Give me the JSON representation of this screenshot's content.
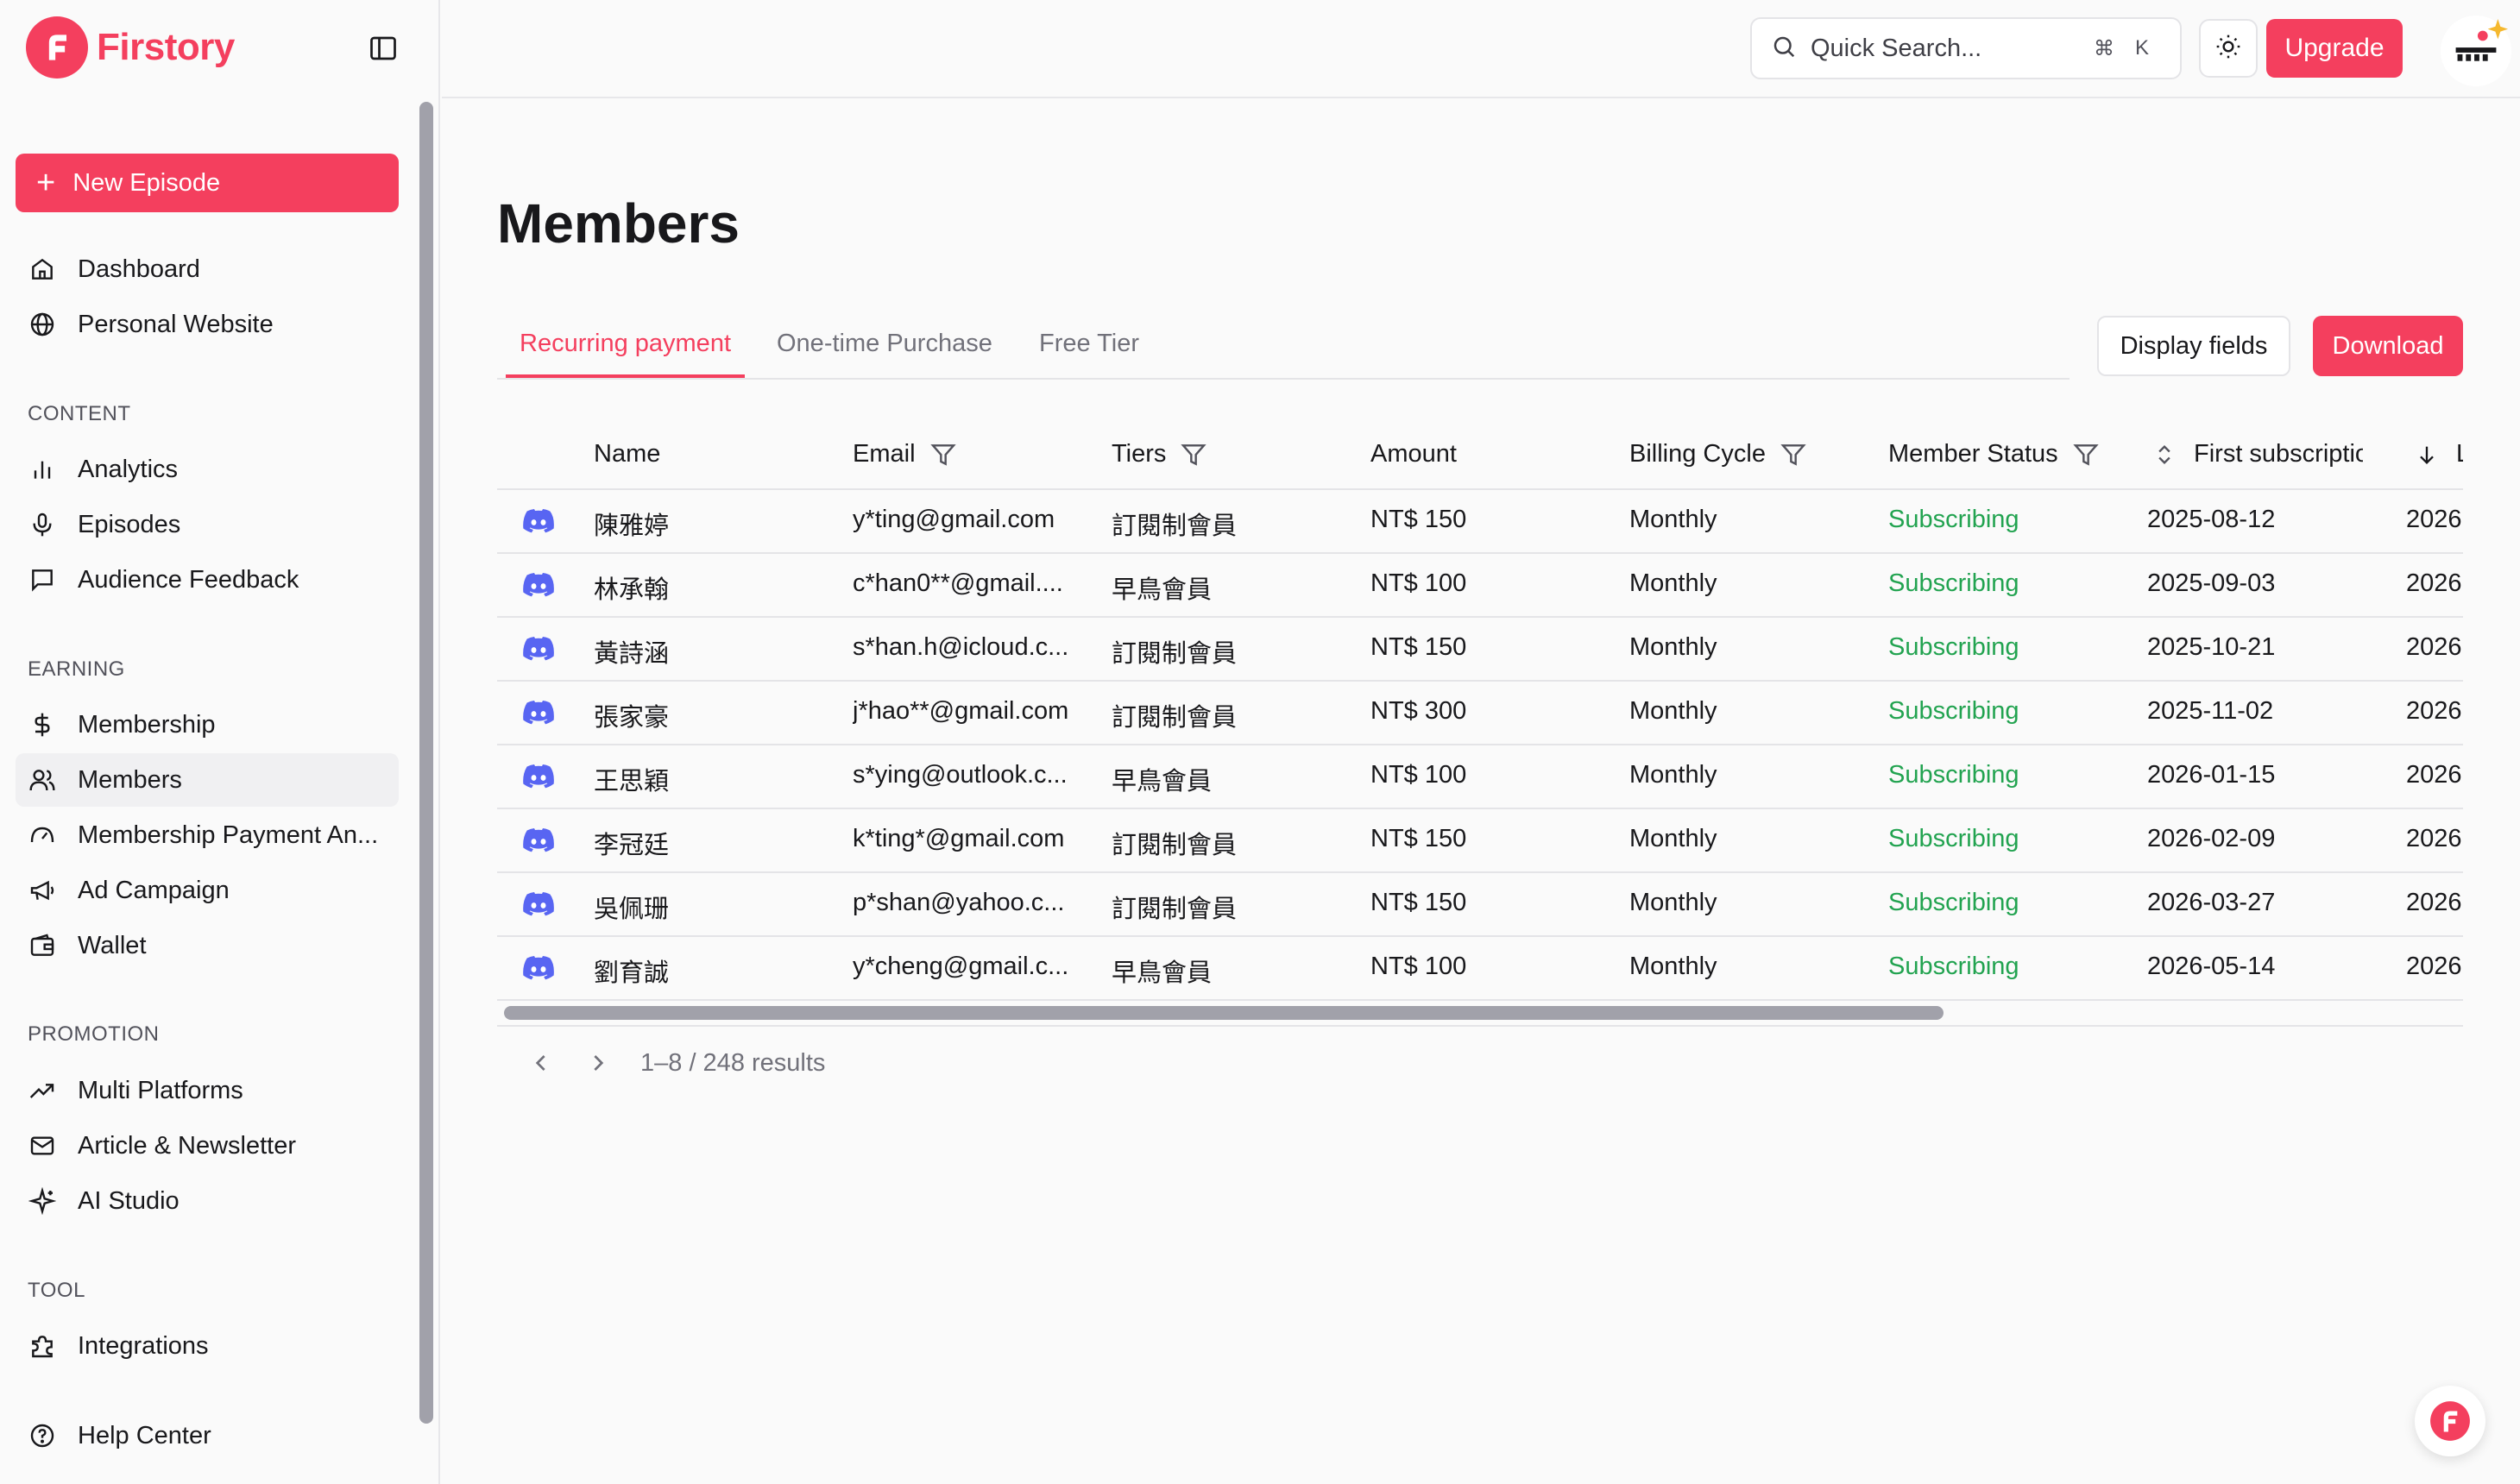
{
  "brand": {
    "name": "Firstory"
  },
  "sidebar": {
    "new_episode_label": "New Episode",
    "top_items": [
      {
        "label": "Dashboard",
        "icon": "home-icon"
      },
      {
        "label": "Personal Website",
        "icon": "globe-icon"
      }
    ],
    "sections": [
      {
        "title": "CONTENT",
        "items": [
          {
            "label": "Analytics",
            "icon": "bar-chart-icon"
          },
          {
            "label": "Episodes",
            "icon": "microphone-icon"
          },
          {
            "label": "Audience Feedback",
            "icon": "message-square-icon"
          }
        ]
      },
      {
        "title": "EARNING",
        "items": [
          {
            "label": "Membership",
            "icon": "dollar-icon"
          },
          {
            "label": "Members",
            "icon": "users-icon",
            "active": true
          },
          {
            "label": "Membership Payment An...",
            "icon": "gauge-icon"
          },
          {
            "label": "Ad Campaign",
            "icon": "megaphone-icon"
          },
          {
            "label": "Wallet",
            "icon": "wallet-icon"
          }
        ]
      },
      {
        "title": "PROMOTION",
        "items": [
          {
            "label": "Multi Platforms",
            "icon": "trending-up-icon"
          },
          {
            "label": "Article & Newsletter",
            "icon": "mail-icon"
          },
          {
            "label": "AI Studio",
            "icon": "sparkles-icon"
          }
        ]
      },
      {
        "title": "TOOL",
        "items": [
          {
            "label": "Integrations",
            "icon": "puzzle-icon"
          }
        ]
      }
    ],
    "help_label": "Help Center"
  },
  "topbar": {
    "search_placeholder": "Quick Search...",
    "shortcut_cmd": "⌘",
    "shortcut_key": "K",
    "upgrade_label": "Upgrade"
  },
  "main": {
    "title": "Members",
    "tabs": [
      "Recurring payment",
      "One-time Purchase",
      "Free Tier"
    ],
    "active_tab": 0,
    "display_fields_label": "Display fields",
    "download_label": "Download",
    "accent": "#f43f5e",
    "status_color": "#22a350"
  },
  "table": {
    "columns": [
      "Name",
      "Email",
      "Tiers",
      "Amount",
      "Billing Cycle",
      "Member Status",
      "First subscriptio",
      "L"
    ],
    "rows": [
      {
        "platform": "discord-icon",
        "name": "陳雅婷",
        "email": "y*ting@gmail.com",
        "tier": "訂閱制會員",
        "amount": "NT$ 150",
        "cycle": "Monthly",
        "status": "Subscribing",
        "first": "2025-08-12",
        "last": "2026"
      },
      {
        "platform": "discord-icon",
        "name": "林承翰",
        "email": "c*han0**@gmail....",
        "tier": "早鳥會員",
        "amount": "NT$ 100",
        "cycle": "Monthly",
        "status": "Subscribing",
        "first": "2025-09-03",
        "last": "2026"
      },
      {
        "platform": "discord-icon",
        "name": "黃詩涵",
        "email": "s*han.h@icloud.c...",
        "tier": "訂閱制會員",
        "amount": "NT$ 150",
        "cycle": "Monthly",
        "status": "Subscribing",
        "first": "2025-10-21",
        "last": "2026"
      },
      {
        "platform": "discord-icon",
        "name": "張家豪",
        "email": "j*hao**@gmail.com",
        "tier": "訂閱制會員",
        "amount": "NT$ 300",
        "cycle": "Monthly",
        "status": "Subscribing",
        "first": "2025-11-02",
        "last": "2026"
      },
      {
        "platform": "discord-icon",
        "name": "王思穎",
        "email": "s*ying@outlook.c...",
        "tier": "早鳥會員",
        "amount": "NT$ 100",
        "cycle": "Monthly",
        "status": "Subscribing",
        "first": "2026-01-15",
        "last": "2026"
      },
      {
        "platform": "discord-icon",
        "name": "李冠廷",
        "email": "k*ting*@gmail.com",
        "tier": "訂閱制會員",
        "amount": "NT$ 150",
        "cycle": "Monthly",
        "status": "Subscribing",
        "first": "2026-02-09",
        "last": "2026"
      },
      {
        "platform": "discord-icon",
        "name": "吳佩珊",
        "email": "p*shan@yahoo.c...",
        "tier": "訂閱制會員",
        "amount": "NT$ 150",
        "cycle": "Monthly",
        "status": "Subscribing",
        "first": "2026-03-27",
        "last": "2026"
      },
      {
        "platform": "discord-icon",
        "name": "劉育誠",
        "email": "y*cheng@gmail.c...",
        "tier": "早鳥會員",
        "amount": "NT$ 100",
        "cycle": "Monthly",
        "status": "Subscribing",
        "first": "2026-05-14",
        "last": "2026"
      }
    ]
  },
  "pagination": {
    "results_text": "1–8 / 248 results"
  }
}
